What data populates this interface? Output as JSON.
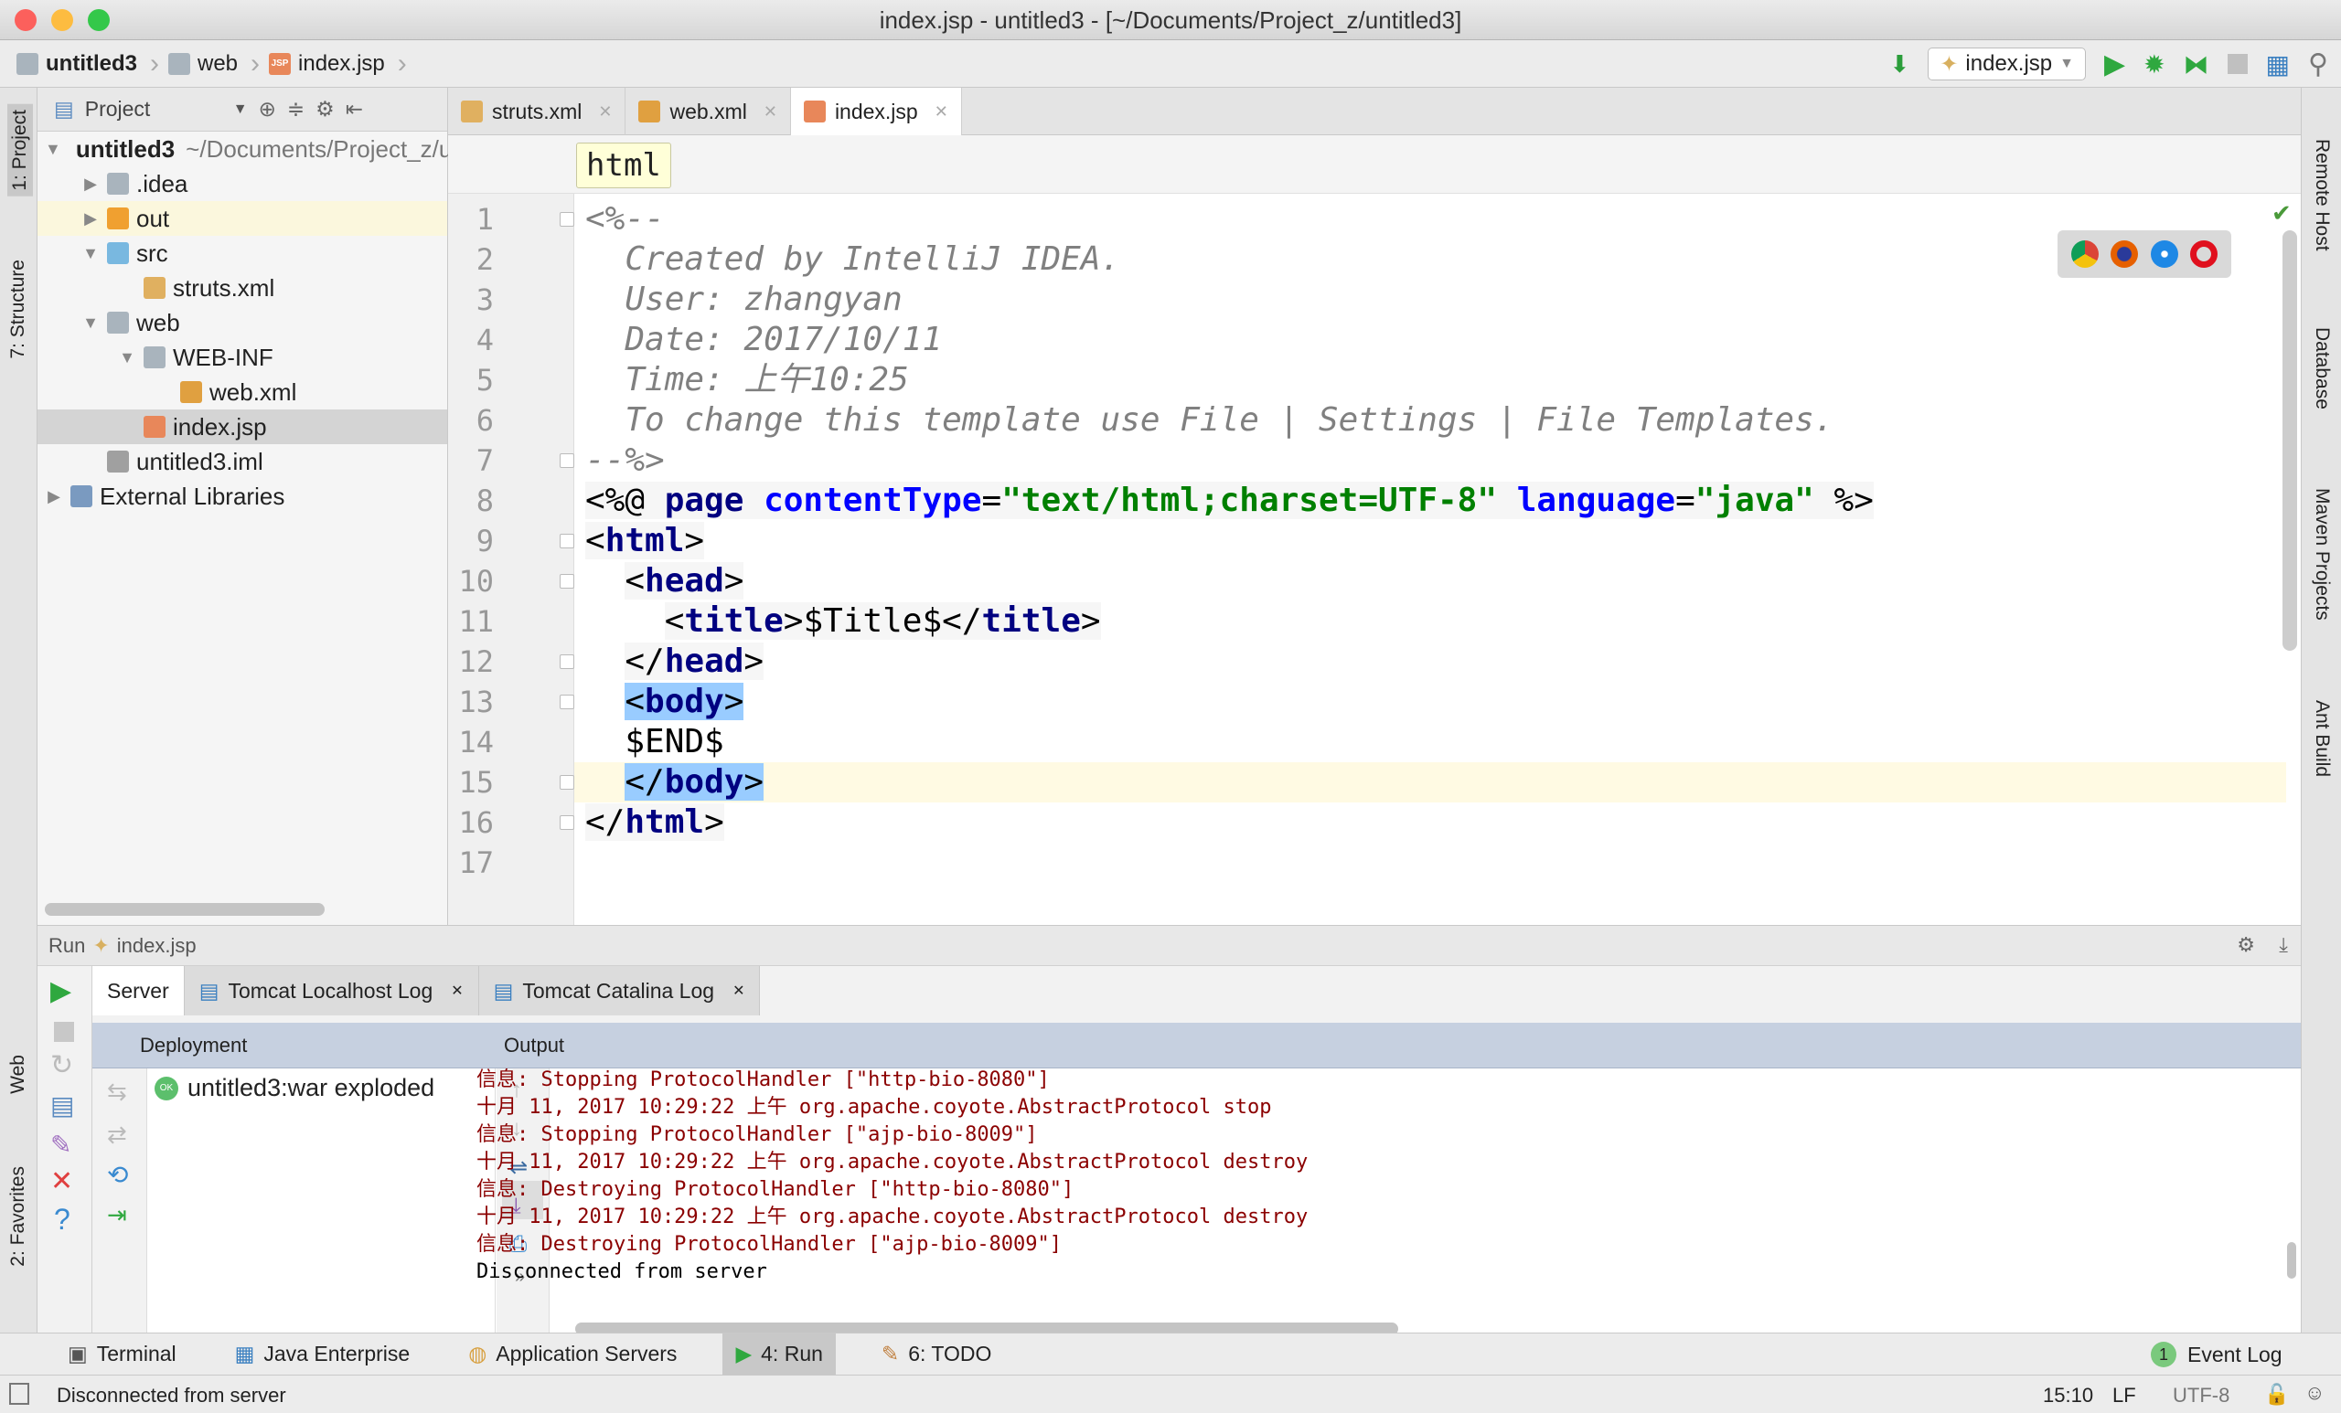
{
  "window": {
    "title": "index.jsp - untitled3 - [~/Documents/Project_z/untitled3]"
  },
  "breadcrumb": [
    {
      "label": "untitled3",
      "icon": "module-folder-icon"
    },
    {
      "label": "web",
      "icon": "web-folder-icon"
    },
    {
      "label": "index.jsp",
      "icon": "jsp-file-icon"
    }
  ],
  "toolbar": {
    "run_config": "index.jsp",
    "icons": [
      "build-icon",
      "run-icon",
      "debug-icon",
      "coverage-icon",
      "stop-icon",
      "project-structure-icon",
      "search-icon"
    ]
  },
  "left_strip": {
    "project": "1: Project",
    "structure": "7: Structure",
    "web": "Web",
    "favorites": "2: Favorites"
  },
  "right_strip": {
    "remote": "Remote Host",
    "database": "Database",
    "maven": "Maven Projects",
    "ant": "Ant Build"
  },
  "project_panel": {
    "title": "Project",
    "tree": [
      {
        "label": "untitled3",
        "extra": "~/Documents/Project_z/untitled3",
        "depth": 0,
        "expanded": true,
        "bold": true,
        "icon": "module-folder-icon"
      },
      {
        "label": ".idea",
        "depth": 1,
        "expanded": false,
        "icon": "folder-icon"
      },
      {
        "label": "out",
        "depth": 1,
        "expanded": false,
        "icon": "excluded-folder-icon",
        "highlight": true
      },
      {
        "label": "src",
        "depth": 1,
        "expanded": true,
        "icon": "source-folder-icon"
      },
      {
        "label": "struts.xml",
        "depth": 2,
        "icon": "struts-xml-icon"
      },
      {
        "label": "web",
        "depth": 1,
        "expanded": true,
        "icon": "web-folder-icon"
      },
      {
        "label": "WEB-INF",
        "depth": 2,
        "expanded": true,
        "icon": "folder-icon"
      },
      {
        "label": "web.xml",
        "depth": 3,
        "icon": "web-xml-icon"
      },
      {
        "label": "index.jsp",
        "depth": 2,
        "icon": "jsp-file-icon",
        "selected": true
      },
      {
        "label": "untitled3.iml",
        "depth": 1,
        "icon": "iml-file-icon"
      },
      {
        "label": "External Libraries",
        "depth": 0,
        "expanded": false,
        "icon": "library-icon"
      }
    ]
  },
  "editor_tabs": [
    {
      "label": "struts.xml",
      "active": false
    },
    {
      "label": "web.xml",
      "active": false
    },
    {
      "label": "index.jsp",
      "active": true
    }
  ],
  "editor": {
    "crumb": "html",
    "current_line": 15,
    "lines": [
      [
        {
          "t": "cm",
          "v": "<%--"
        }
      ],
      [
        {
          "t": "cm",
          "v": "  Created by IntelliJ IDEA."
        }
      ],
      [
        {
          "t": "cm",
          "v": "  User: zhangyan"
        }
      ],
      [
        {
          "t": "cm",
          "v": "  Date: 2017/10/11"
        }
      ],
      [
        {
          "t": "cm",
          "v": "  Time: 上午10:25"
        }
      ],
      [
        {
          "t": "cm",
          "v": "  To change this template use File | Settings | File Templates."
        }
      ],
      [
        {
          "t": "cm",
          "v": "--%>"
        }
      ],
      [
        {
          "t": "pl dir",
          "v": "<%@ "
        },
        {
          "t": "tag dir",
          "v": "page "
        },
        {
          "t": "att dir",
          "v": "contentType"
        },
        {
          "t": "pl dir",
          "v": "="
        },
        {
          "t": "str dir",
          "v": "\"text/html;charset=UTF-8\" "
        },
        {
          "t": "att dir",
          "v": "language"
        },
        {
          "t": "pl dir",
          "v": "="
        },
        {
          "t": "str dir",
          "v": "\"java\""
        },
        {
          "t": "pl dir",
          "v": " %>"
        }
      ],
      [
        {
          "t": "pl dir",
          "v": "<"
        },
        {
          "t": "tag dir",
          "v": "html"
        },
        {
          "t": "pl dir",
          "v": ">"
        }
      ],
      [
        {
          "t": "pl",
          "v": "  "
        },
        {
          "t": "pl dir",
          "v": "<"
        },
        {
          "t": "tag dir",
          "v": "head"
        },
        {
          "t": "pl dir",
          "v": ">"
        }
      ],
      [
        {
          "t": "pl",
          "v": "    "
        },
        {
          "t": "pl dir",
          "v": "<"
        },
        {
          "t": "tag dir",
          "v": "title"
        },
        {
          "t": "pl dir",
          "v": ">$Title$</"
        },
        {
          "t": "tag dir",
          "v": "title"
        },
        {
          "t": "pl dir",
          "v": ">"
        }
      ],
      [
        {
          "t": "pl",
          "v": "  "
        },
        {
          "t": "pl dir",
          "v": "</"
        },
        {
          "t": "tag dir",
          "v": "head"
        },
        {
          "t": "pl dir",
          "v": ">"
        }
      ],
      [
        {
          "t": "pl",
          "v": "  "
        },
        {
          "t": "pl hl",
          "v": "<"
        },
        {
          "t": "tag hl",
          "v": "body"
        },
        {
          "t": "pl hl",
          "v": ">"
        }
      ],
      [
        {
          "t": "pl",
          "v": "  $END$"
        }
      ],
      [
        {
          "t": "pl",
          "v": "  "
        },
        {
          "t": "pl hl",
          "v": "</"
        },
        {
          "t": "tag hl",
          "v": "body"
        },
        {
          "t": "pl hl",
          "v": ">"
        }
      ],
      [
        {
          "t": "pl dir",
          "v": "</"
        },
        {
          "t": "tag dir",
          "v": "html"
        },
        {
          "t": "pl dir",
          "v": ">"
        }
      ],
      []
    ],
    "browsers": [
      "chrome-icon",
      "firefox-icon",
      "safari-icon",
      "opera-icon"
    ]
  },
  "run_panel": {
    "label": "Run",
    "config": "index.jsp",
    "tabs": [
      {
        "label": "Server",
        "active": true
      },
      {
        "label": "Tomcat Localhost Log"
      },
      {
        "label": "Tomcat Catalina Log"
      }
    ],
    "deployment_header": "Deployment",
    "output_header": "Output",
    "deployment_items": [
      {
        "label": "untitled3:war exploded",
        "status": "OK"
      }
    ],
    "output": [
      {
        "text": "信息: Stopping ProtocolHandler [\"http-bio-8080\"]",
        "color": "#8b0000"
      },
      {
        "text": "十月 11, 2017 10:29:22 上午 org.apache.coyote.AbstractProtocol stop",
        "color": "#8b0000"
      },
      {
        "text": "信息: Stopping ProtocolHandler [\"ajp-bio-8009\"]",
        "color": "#8b0000"
      },
      {
        "text": "十月 11, 2017 10:29:22 上午 org.apache.coyote.AbstractProtocol destroy",
        "color": "#8b0000"
      },
      {
        "text": "信息: Destroying ProtocolHandler [\"http-bio-8080\"]",
        "color": "#8b0000"
      },
      {
        "text": "十月 11, 2017 10:29:22 上午 org.apache.coyote.AbstractProtocol destroy",
        "color": "#8b0000"
      },
      {
        "text": "信息: Destroying ProtocolHandler [\"ajp-bio-8009\"]",
        "color": "#8b0000"
      },
      {
        "text": "Disconnected from server",
        "color": "#000000"
      }
    ]
  },
  "bottom_tools": [
    {
      "label": "Terminal"
    },
    {
      "label": "Java Enterprise"
    },
    {
      "label": "Application Servers"
    },
    {
      "label": "4: Run",
      "active": true
    },
    {
      "label": "6: TODO"
    }
  ],
  "event_log": {
    "label": "Event Log",
    "count": "1"
  },
  "status": {
    "message": "Disconnected from server",
    "position": "15:10",
    "line_sep": "LF",
    "encoding": "UTF-8"
  }
}
